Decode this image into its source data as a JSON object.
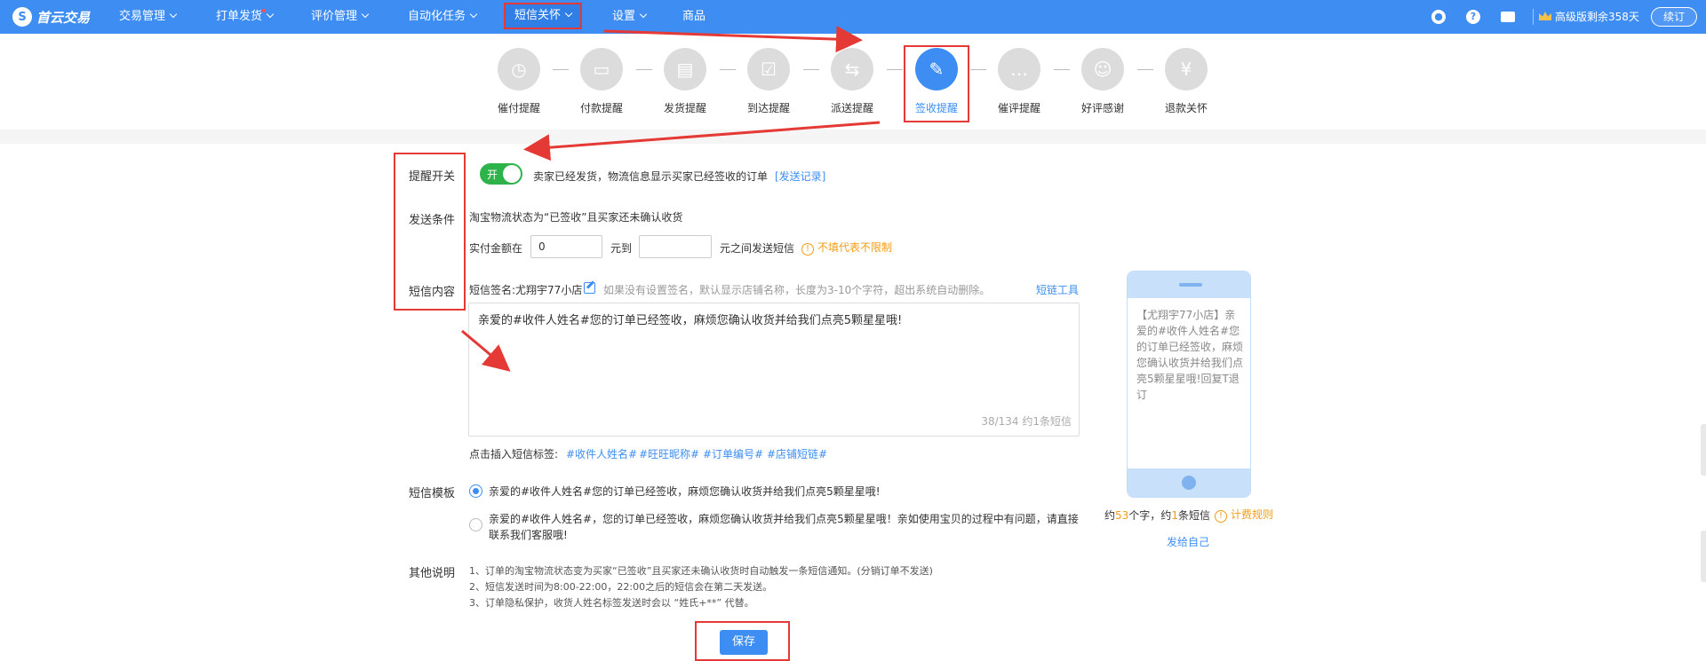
{
  "topbar": {
    "logo_text": "首云交易",
    "logo_glyph": "S",
    "nav": [
      {
        "label": "交易管理",
        "has_chevron": true
      },
      {
        "label": "打单发货",
        "has_chevron": true,
        "has_dot": true
      },
      {
        "label": "评价管理",
        "has_chevron": true
      },
      {
        "label": "自动化任务",
        "has_chevron": true
      },
      {
        "label": "短信关怀",
        "has_chevron": true,
        "active": true
      },
      {
        "label": "设置",
        "has_chevron": true
      },
      {
        "label": "商品",
        "has_chevron": false
      }
    ],
    "icons": [
      "robot-icon",
      "help-icon",
      "ticket-icon"
    ],
    "help_glyph": "?",
    "vip_text": "高级版剩余358天",
    "renew_label": "续订"
  },
  "steps": [
    {
      "label": "催付提醒",
      "icon": "clock-icon",
      "glyph": "◷"
    },
    {
      "label": "付款提醒",
      "icon": "wallet-icon",
      "glyph": "▭"
    },
    {
      "label": "发货提醒",
      "icon": "package-icon",
      "glyph": "▤"
    },
    {
      "label": "到达提醒",
      "icon": "arrival-icon",
      "glyph": "☑"
    },
    {
      "label": "派送提醒",
      "icon": "delivery-icon",
      "glyph": "⇆"
    },
    {
      "label": "签收提醒",
      "icon": "signed-icon",
      "glyph": "✎",
      "active": true
    },
    {
      "label": "催评提醒",
      "icon": "chat-icon",
      "glyph": "…"
    },
    {
      "label": "好评感谢",
      "icon": "thanks-icon",
      "glyph": "☺"
    },
    {
      "label": "退款关怀",
      "icon": "refund-icon",
      "glyph": "¥"
    }
  ],
  "form": {
    "reminder_switch": {
      "label": "提醒开关",
      "toggle_text": "开",
      "description": "卖家已经发货，物流信息显示买家已经签收的订单",
      "history_link": "[发送记录]"
    },
    "send_condition": {
      "label": "发送条件",
      "text": "淘宝物流状态为“已签收”且买家还未确认收货",
      "amount_prefix": "实付金额在",
      "amount_from": "0",
      "amount_mid": "元到",
      "amount_to": "",
      "amount_suffix": "元之间发送短信",
      "hint": "不填代表不限制",
      "hint_glyph": "!"
    },
    "sms_content": {
      "label": "短信内容",
      "signature_text": "短信签名:尤翔宇77小店",
      "signature_hint": "如果没有设置签名，默认显示店铺名称，长度为3-10个字符，超出系统自动删除。",
      "tool_link": "短链工具",
      "message": "亲爱的#收件人姓名#您的订单已经签收，麻烦您确认收货并给我们点亮5颗星星哦!",
      "count": "38/134  约1条短信",
      "insert_prefix": "点击插入短信标签:",
      "tags": [
        "#收件人姓名#",
        "#旺旺昵称#",
        "#订单编号#",
        "#店铺短链#"
      ]
    },
    "template": {
      "label": "短信模板",
      "options": [
        {
          "text": "亲爱的#收件人姓名#您的订单已经签收，麻烦您确认收货并给我们点亮5颗星星哦!",
          "checked": true
        },
        {
          "line1": "亲爱的#收件人姓名#，您的订单已经签收，麻烦您确认收货并给我们点亮5颗星星哦！亲如使用宝贝的过程中有问题，请直接",
          "line2": "联系我们客服哦!",
          "checked": false
        }
      ]
    },
    "notes": {
      "label": "其他说明",
      "items": [
        "1、订单的淘宝物流状态变为买家“已签收”且买家还未确认收货时自动触发一条短信通知。(分销订单不发送)",
        "2、短信发送时间为8:00-22:00，22:00之后的短信会在第二天发送。",
        "3、订单隐私保护，收货人姓名标签发送时会以 “姓氏+**” 代替。"
      ]
    },
    "save_label": "保存"
  },
  "preview": {
    "text": "【尤翔宇77小店】亲爱的#收件人姓名#您的订单已经签收，麻烦您确认收货并给我们点亮5颗星星哦!回复T退订",
    "count_prefix": "约",
    "count_chars": "53",
    "count_mid": "个字，约",
    "count_msgs": "1",
    "count_suffix": "条短信",
    "rule_link": "计费规则",
    "rule_glyph": "!",
    "send_self_link": "发给自己"
  },
  "colors": {
    "primary": "#3d8df2",
    "toggle_on": "#2eb24a",
    "highlight_red": "#e53935",
    "warning": "#f39c12"
  }
}
